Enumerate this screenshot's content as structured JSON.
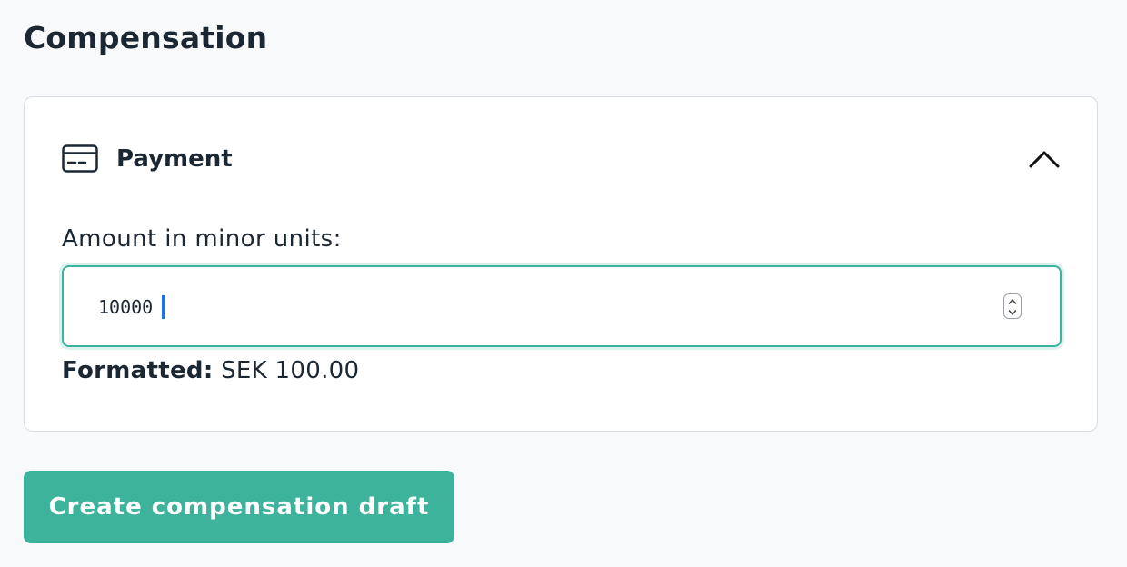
{
  "page": {
    "title": "Compensation"
  },
  "payment_card": {
    "icon": "credit-card-icon",
    "title": "Payment",
    "collapse_icon": "chevron-up-icon",
    "amount_field": {
      "label": "Amount in minor units:",
      "value": "10000"
    },
    "formatted": {
      "label": "Formatted:",
      "value": "SEK 100.00"
    }
  },
  "actions": {
    "create_button_label": "Create compensation draft"
  },
  "colors": {
    "accent": "#3db39b",
    "text": "#1b2733",
    "background": "#f8f9fa",
    "card_border": "#d9dde1"
  }
}
